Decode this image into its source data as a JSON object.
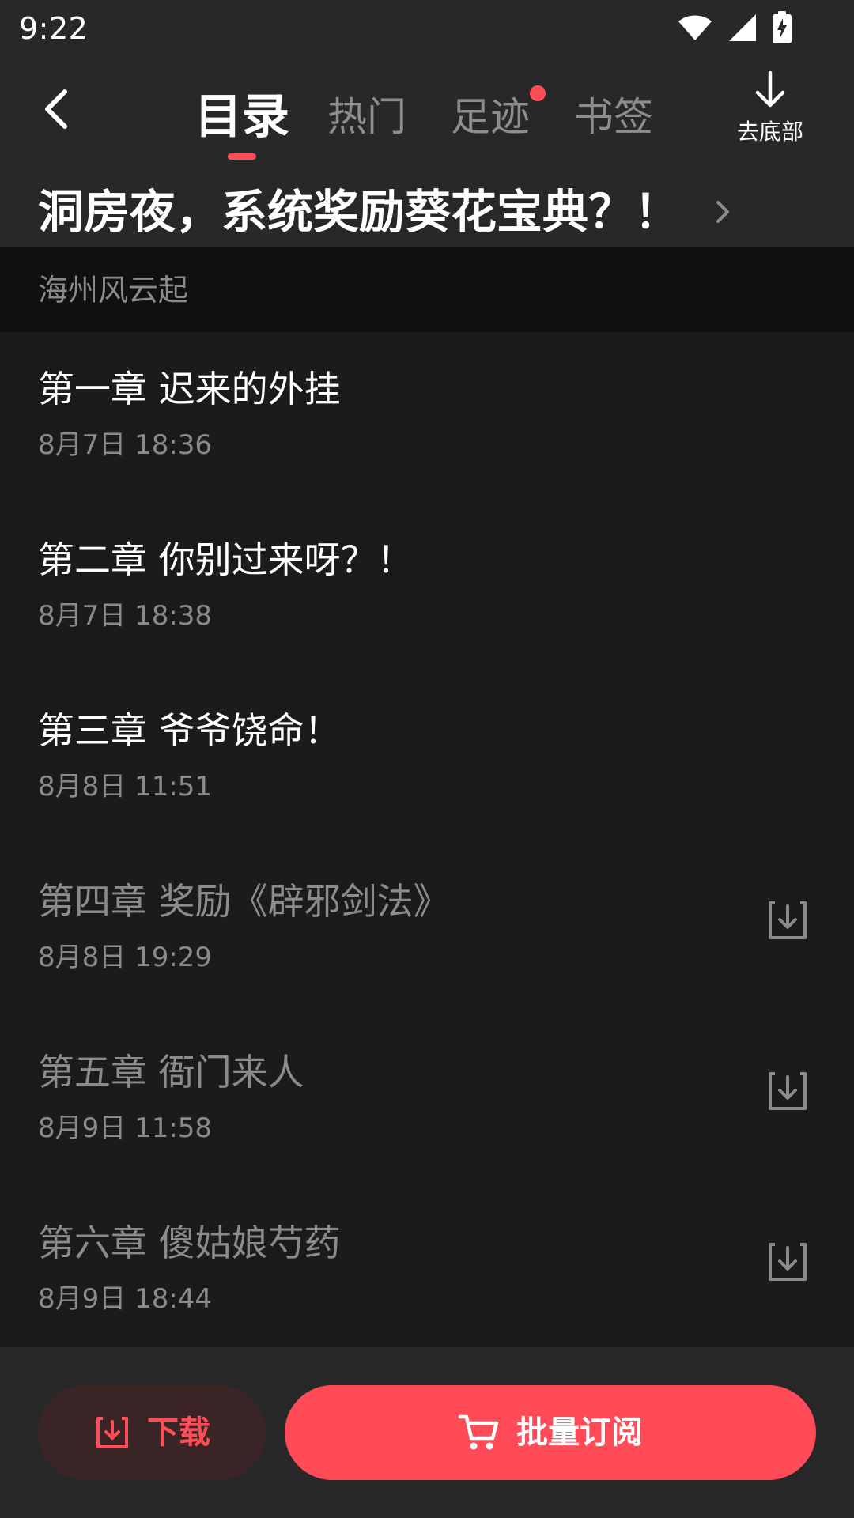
{
  "status_bar": {
    "time": "9:22",
    "wifi_icon": "wifi-icon",
    "signal_icon": "signal-icon",
    "battery_icon": "battery-charging-icon"
  },
  "header": {
    "back_icon": "chevron-left-icon",
    "tabs": [
      {
        "label": "目录",
        "active": true,
        "has_dot": false
      },
      {
        "label": "热门",
        "active": false,
        "has_dot": false
      },
      {
        "label": "足迹",
        "active": false,
        "has_dot": true
      },
      {
        "label": "书签",
        "active": false,
        "has_dot": false
      }
    ],
    "to_bottom_label": "去底部",
    "to_bottom_icon": "arrow-down-icon"
  },
  "book": {
    "title": "洞房夜，系统奖励葵花宝典？！",
    "arrow_icon": "chevron-right-icon"
  },
  "volume": {
    "title": "海州风云起"
  },
  "chapters": [
    {
      "title": "第一章 迟来的外挂",
      "time": "8月7日 18:36",
      "locked": false
    },
    {
      "title": "第二章 你别过来呀？！",
      "time": "8月7日 18:38",
      "locked": false
    },
    {
      "title": "第三章 爷爷饶命！",
      "time": "8月8日 11:51",
      "locked": false
    },
    {
      "title": "第四章 奖励《辟邪剑法》",
      "time": "8月8日 19:29",
      "locked": true
    },
    {
      "title": "第五章 衙门来人",
      "time": "8月9日 11:58",
      "locked": true
    },
    {
      "title": "第六章 傻姑娘芍药",
      "time": "8月9日 18:44",
      "locked": true
    }
  ],
  "bottom_bar": {
    "download_label": "下载",
    "download_icon": "download-icon",
    "subscribe_label": "批量订阅",
    "subscribe_icon": "cart-icon"
  },
  "colors": {
    "accent": "#ff4d57",
    "header_bg": "#282828",
    "list_bg": "#1b1b1b",
    "volume_bg": "#101010",
    "muted_text": "#8a8a8a"
  }
}
